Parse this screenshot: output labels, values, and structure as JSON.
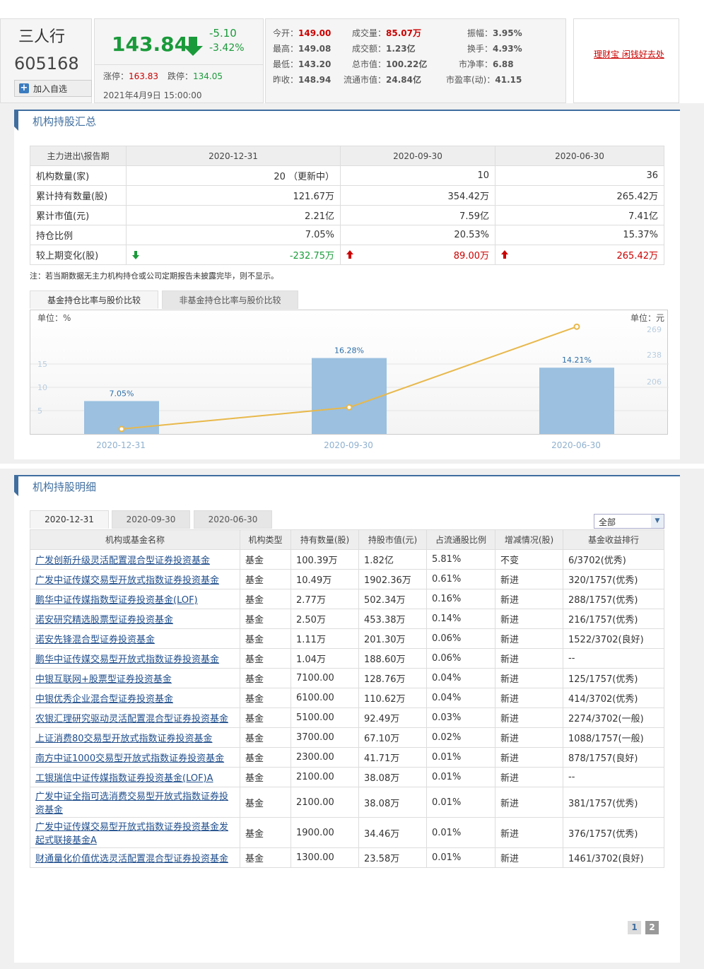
{
  "quote": {
    "name": "三人行",
    "code": "605168",
    "add_label": "加入自选",
    "price": "143.84",
    "change": "-5.10",
    "change_pct": "-3.42%",
    "limit_up_label": "涨停：",
    "limit_up": "163.83",
    "limit_down_label": "跌停：",
    "limit_down": "134.05",
    "datetime": "2021年4月9日 15:00:00",
    "stats": [
      {
        "label": "今开：",
        "value": "149.00"
      },
      {
        "label": "最高：",
        "value": "149.08"
      },
      {
        "label": "最低：",
        "value": "143.20"
      },
      {
        "label": "昨收：",
        "value": "148.94"
      },
      {
        "label": "成交量：",
        "value": "85.07万"
      },
      {
        "label": "成交额：",
        "value": "1.23亿"
      },
      {
        "label": "总市值：",
        "value": "100.22亿"
      },
      {
        "label": "流通市值：",
        "value": "24.84亿"
      },
      {
        "label": "振幅：",
        "value": "3.95%"
      },
      {
        "label": "换手：",
        "value": "4.93%"
      },
      {
        "label": "市净率：",
        "value": "6.88"
      },
      {
        "label": "市盈率(动)：",
        "value": "41.15"
      }
    ],
    "ad_link": "理财宝 闲钱好去处"
  },
  "summary": {
    "title": "机构持股汇总",
    "headers": [
      "主力进出\\报告期",
      "2020-12-31",
      "2020-09-30",
      "2020-06-30"
    ],
    "rows": [
      {
        "label": "机构数量(家)",
        "values": [
          "20 （更新中）",
          "10",
          "36"
        ]
      },
      {
        "label": "累计持有数量(股)",
        "values": [
          "121.67万",
          "354.42万",
          "265.42万"
        ]
      },
      {
        "label": "累计市值(元)",
        "values": [
          "2.21亿",
          "7.59亿",
          "7.41亿"
        ]
      },
      {
        "label": "持仓比例",
        "values": [
          "7.05%",
          "20.53%",
          "15.37%"
        ]
      },
      {
        "label": "较上期变化(股)",
        "values": [
          "-232.75万",
          "89.00万",
          "265.42万"
        ]
      }
    ],
    "note": "注：若当期数据无主力机构持仓或公司定期报告未披露完毕，则不显示。"
  },
  "chart_tabs": [
    "基金持仓比率与股价比较",
    "非基金持仓比率与股价比较"
  ],
  "chart_data": {
    "type": "bar",
    "categories": [
      "2020-12-31",
      "2020-09-30",
      "2020-06-30"
    ],
    "series": [
      {
        "values": [
          7.05,
          16.28,
          14.21
        ],
        "value_labels": [
          "7.05%",
          "16.28%",
          "14.21%"
        ]
      },
      {
        "values": [
          149,
          175,
          272
        ]
      }
    ],
    "ylabel_left": "单位：%",
    "ylabel_right": "单位：元",
    "left_ticks": [
      "15",
      "10",
      "5"
    ],
    "right_ticks": [
      "269",
      "238",
      "206"
    ],
    "ylim_left": [
      0,
      20
    ],
    "ylim_right": [
      143,
      296
    ],
    "colors": {
      "bar": "#9bc0e0",
      "line": "#e8b84a"
    }
  },
  "detail": {
    "title": "机构持股明细",
    "tabs": [
      "2020-12-31",
      "2020-09-30",
      "2020-06-30"
    ],
    "filter": "全部",
    "headers": [
      "机构或基金名称",
      "机构类型",
      "持有数量(股)",
      "持股市值(元)",
      "占流通股比例",
      "增减情况(股)",
      "基金收益排行"
    ],
    "rows": [
      [
        "广发创新升级灵活配置混合型证券投资基金",
        "基金",
        "100.39万",
        "1.82亿",
        "5.81%",
        "不变",
        "6/3702(优秀)"
      ],
      [
        "广发中证传媒交易型开放式指数证券投资基金",
        "基金",
        "10.49万",
        "1902.36万",
        "0.61%",
        "新进",
        "320/1757(优秀)"
      ],
      [
        "鹏华中证传媒指数型证券投资基金(LOF)",
        "基金",
        "2.77万",
        "502.34万",
        "0.16%",
        "新进",
        "288/1757(优秀)"
      ],
      [
        "诺安研究精选股票型证券投资基金",
        "基金",
        "2.50万",
        "453.38万",
        "0.14%",
        "新进",
        "216/1757(优秀)"
      ],
      [
        "诺安先锋混合型证券投资基金",
        "基金",
        "1.11万",
        "201.30万",
        "0.06%",
        "新进",
        "1522/3702(良好)"
      ],
      [
        "鹏华中证传媒交易型开放式指数证券投资基金",
        "基金",
        "1.04万",
        "188.60万",
        "0.06%",
        "新进",
        "--"
      ],
      [
        "中银互联网+股票型证券投资基金",
        "基金",
        "7100.00",
        "128.76万",
        "0.04%",
        "新进",
        "125/1757(优秀)"
      ],
      [
        "中银优秀企业混合型证券投资基金",
        "基金",
        "6100.00",
        "110.62万",
        "0.04%",
        "新进",
        "414/3702(优秀)"
      ],
      [
        "农银汇理研究驱动灵活配置混合型证券投资基金",
        "基金",
        "5100.00",
        "92.49万",
        "0.03%",
        "新进",
        "2274/3702(一般)"
      ],
      [
        "上证消费80交易型开放式指数证券投资基金",
        "基金",
        "3700.00",
        "67.10万",
        "0.02%",
        "新进",
        "1088/1757(一般)"
      ],
      [
        "南方中证1000交易型开放式指数证券投资基金",
        "基金",
        "2300.00",
        "41.71万",
        "0.01%",
        "新进",
        "878/1757(良好)"
      ],
      [
        "工银瑞信中证传媒指数证券投资基金(LOF)A",
        "基金",
        "2100.00",
        "38.08万",
        "0.01%",
        "新进",
        "--"
      ],
      [
        "广发中证全指可选消费交易型开放式指数证券投资基金",
        "基金",
        "2100.00",
        "38.08万",
        "0.01%",
        "新进",
        "381/1757(优秀)"
      ],
      [
        "广发中证传媒交易型开放式指数证券投资基金发起式联接基金A",
        "基金",
        "1900.00",
        "34.46万",
        "0.01%",
        "新进",
        "376/1757(优秀)"
      ],
      [
        "财通量化价值优选灵活配置混合型证券投资基金",
        "基金",
        "1300.00",
        "23.58万",
        "0.01%",
        "新进",
        "1461/3702(良好)"
      ]
    ],
    "pages": [
      "1",
      "2"
    ]
  }
}
